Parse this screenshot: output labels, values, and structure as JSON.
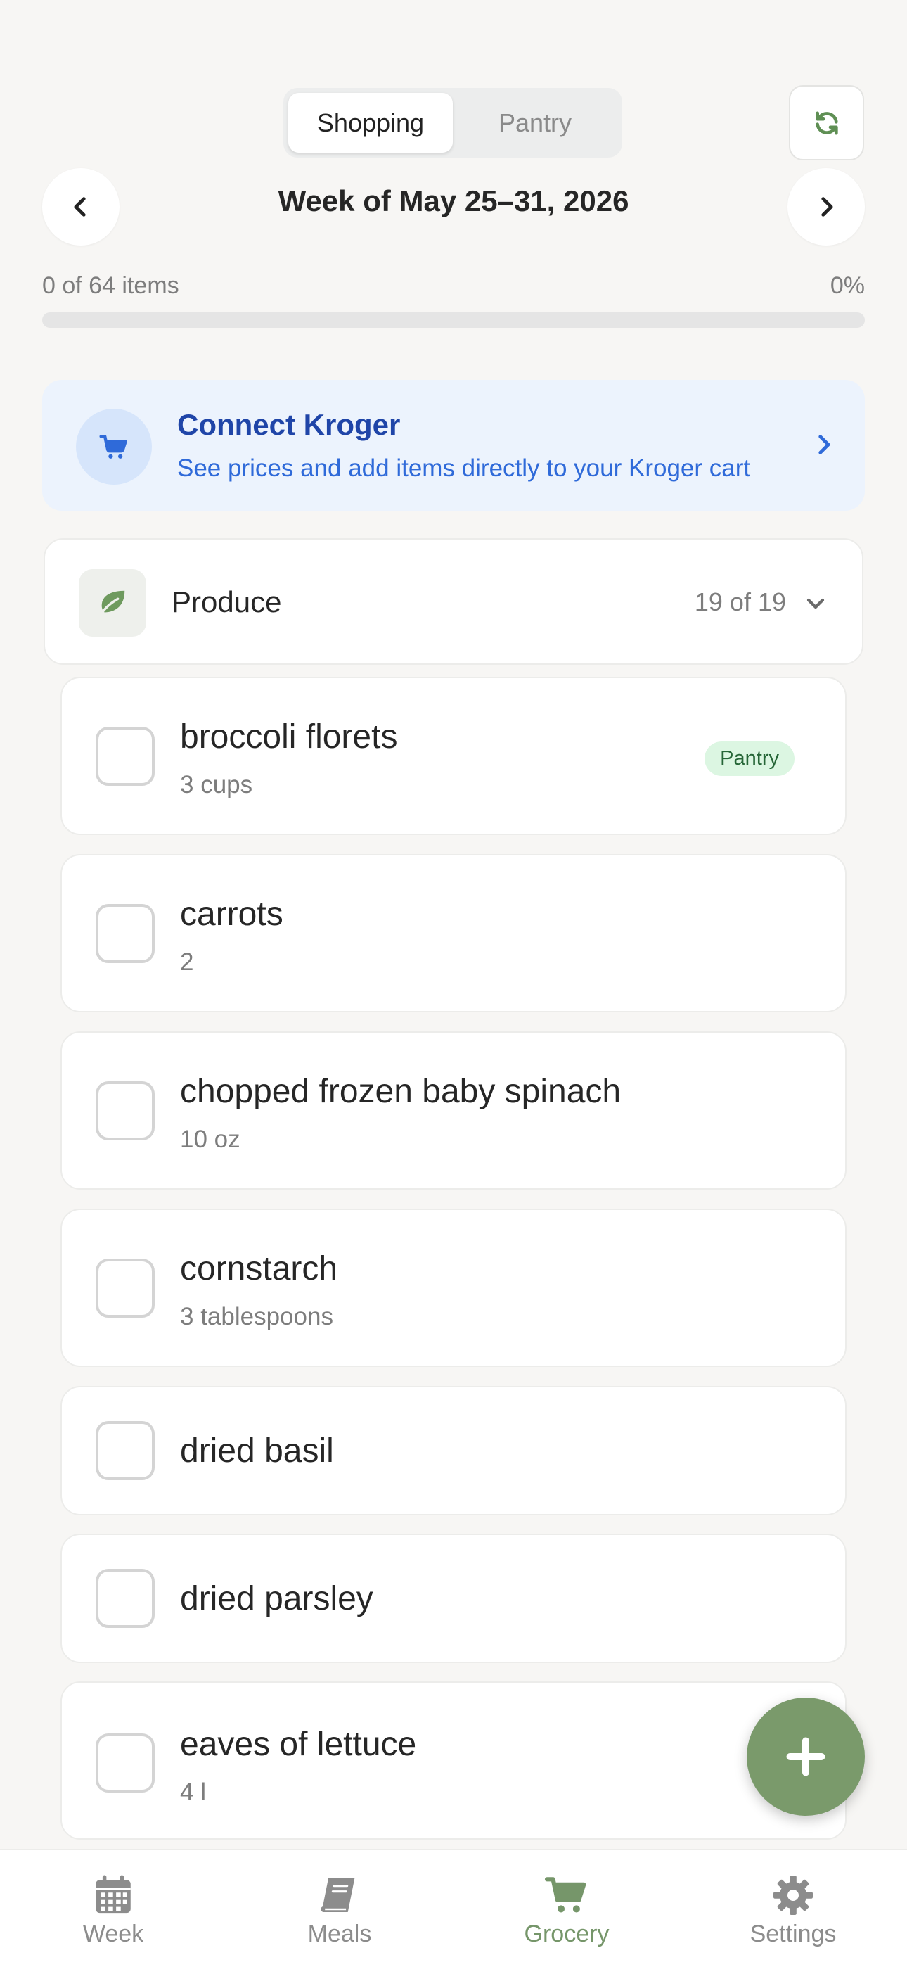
{
  "toggle": {
    "shopping": "Shopping",
    "pantry": "Pantry",
    "active": "Shopping"
  },
  "week": {
    "title": "Week of May 25–31, 2026"
  },
  "progress": {
    "label": "0 of 64 items",
    "percent_text": "0%",
    "fraction": 0
  },
  "kroger": {
    "title": "Connect Kroger",
    "subtitle": "See prices and add items directly to your Kroger cart"
  },
  "category": {
    "name": "Produce",
    "count": "19 of 19",
    "icon": "leaf-icon"
  },
  "items": [
    {
      "name": "broccoli florets",
      "qty": "3 cups",
      "badge": "Pantry"
    },
    {
      "name": "carrots",
      "qty": "2"
    },
    {
      "name": "chopped frozen baby spinach",
      "qty": "10 oz"
    },
    {
      "name": "cornstarch",
      "qty": "3 tablespoons"
    },
    {
      "name": "dried basil",
      "qty": ""
    },
    {
      "name": "dried parsley",
      "qty": ""
    },
    {
      "name": "eaves of lettuce",
      "qty": "4 l"
    }
  ],
  "tabs": [
    {
      "label": "Week",
      "icon": "calendar-icon"
    },
    {
      "label": "Meals",
      "icon": "book-icon"
    },
    {
      "label": "Grocery",
      "icon": "cart-icon",
      "active": true
    },
    {
      "label": "Settings",
      "icon": "gear-icon"
    }
  ],
  "colors": {
    "accent_green": "#7a9a6b",
    "kroger_blue": "#1f45a8",
    "background": "#f7f6f4"
  }
}
